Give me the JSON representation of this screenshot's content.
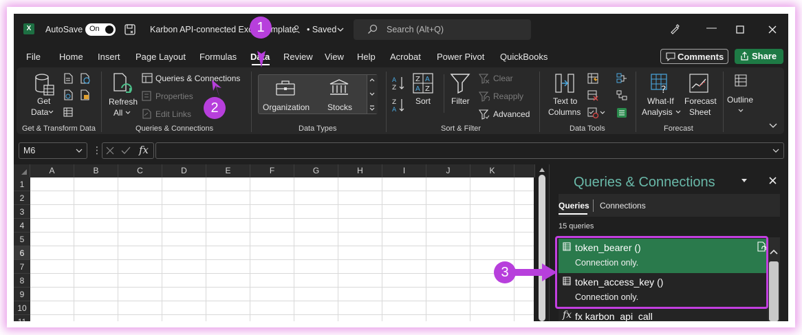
{
  "titlebar": {
    "autosave_label": "AutoSave",
    "autosave_state": "On",
    "file_title": "Karbon API-connected Excel Template",
    "saved_status": "• Saved",
    "search_placeholder": "Search (Alt+Q)"
  },
  "tabs": [
    "File",
    "Home",
    "Insert",
    "Page Layout",
    "Formulas",
    "Data",
    "Review",
    "View",
    "Help",
    "Acrobat",
    "Power Pivot",
    "QuickBooks"
  ],
  "active_tab": "Data",
  "header_buttons": {
    "comments": "Comments",
    "share": "Share"
  },
  "ribbon": {
    "get_transform": {
      "get_data_line1": "Get",
      "get_data_line2": "Data",
      "group_label": "Get & Transform Data"
    },
    "queries": {
      "refresh_line1": "Refresh",
      "refresh_line2": "All",
      "queries_connections": "Queries & Connections",
      "properties": "Properties",
      "edit_links": "Edit Links",
      "group_label": "Queries & Connections"
    },
    "data_types": {
      "organization": "Organization",
      "stocks": "Stocks",
      "group_label": "Data Types"
    },
    "sort_filter": {
      "sort": "Sort",
      "filter": "Filter",
      "clear": "Clear",
      "reapply": "Reapply",
      "advanced": "Advanced",
      "group_label": "Sort & Filter"
    },
    "data_tools": {
      "text_to_columns_line1": "Text to",
      "text_to_columns_line2": "Columns",
      "group_label": "Data Tools"
    },
    "forecast": {
      "what_if_line1": "What-If",
      "what_if_line2": "Analysis",
      "forecast_line1": "Forecast",
      "forecast_line2": "Sheet",
      "group_label": "Forecast"
    },
    "outline": {
      "label": "Outline"
    }
  },
  "formula_bar": {
    "name_box": "M6",
    "fx": "fx",
    "formula": ""
  },
  "grid": {
    "columns": [
      "A",
      "B",
      "C",
      "D",
      "E",
      "F",
      "G",
      "H",
      "I",
      "J",
      "K"
    ],
    "rows": [
      "1",
      "2",
      "3",
      "4",
      "5",
      "6",
      "7",
      "8",
      "9",
      "10",
      "11"
    ],
    "selected_row": "6"
  },
  "pane": {
    "title": "Queries & Connections",
    "tab_queries": "Queries",
    "tab_connections": "Connections",
    "count": "15 queries",
    "items": [
      {
        "name": "token_bearer ()",
        "status": "Connection only."
      },
      {
        "name": "token_access_key ()",
        "status": "Connection only."
      },
      {
        "name": "fx karbon_api_call",
        "status": ""
      }
    ]
  },
  "annotations": [
    "1",
    "2",
    "3"
  ],
  "colors": {
    "highlight": "#c23fe0",
    "badge": "#b73fdc",
    "share_green": "#1e7a45",
    "selected_query": "#2a7a4c",
    "pane_title": "#69b8a8"
  }
}
